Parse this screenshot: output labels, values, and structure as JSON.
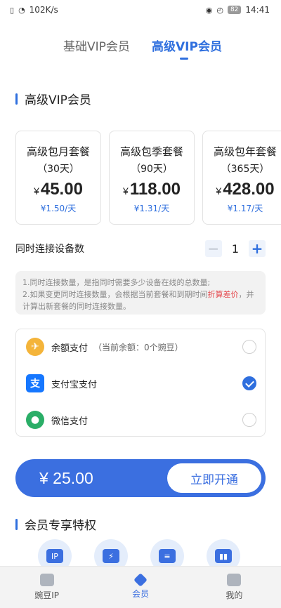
{
  "status_bar": {
    "network_speed": "102K/s",
    "battery": "82",
    "time": "14:41"
  },
  "tabs": {
    "basic": "基础VIP会员",
    "advanced": "高级VIP会员"
  },
  "section_title": "高级VIP会员",
  "plans": [
    {
      "name": "高级包月套餐",
      "days": "（30天）",
      "currency": "¥",
      "price": "45.00",
      "per_day": "¥1.50/天"
    },
    {
      "name": "高级包季套餐",
      "days": "（90天）",
      "currency": "¥",
      "price": "118.00",
      "per_day": "¥1.31/天"
    },
    {
      "name": "高级包年套餐",
      "days": "（365天）",
      "currency": "¥",
      "price": "428.00",
      "per_day": "¥1.17/天"
    }
  ],
  "devices": {
    "label": "同时连接设备数",
    "minus": "−",
    "value": "1",
    "plus": "+"
  },
  "notice": {
    "line1": "1.同时连接数量，是指同时需要多少设备在线的总数量;",
    "line2_prefix": "2.如果变更同时连接数量，会根据当前套餐和到期时间",
    "line2_highlight": "折算差价",
    "line2_suffix": "，并计算出新套餐的同时连接数量。"
  },
  "payment": {
    "balance_label": "余额支付",
    "balance_note": "（当前余额：0个豌豆）",
    "alipay_label": "支付宝支付",
    "wechat_label": "微信支付",
    "selected": "alipay"
  },
  "buy": {
    "total": "¥ 25.00",
    "button": "立即开通"
  },
  "privileges_title": "会员专享特权",
  "bottom_nav": {
    "item1": "豌豆IP",
    "item2": "会员",
    "item3": "我的"
  },
  "colors": {
    "accent": "#2f6fde",
    "highlight": "#e5484d"
  }
}
